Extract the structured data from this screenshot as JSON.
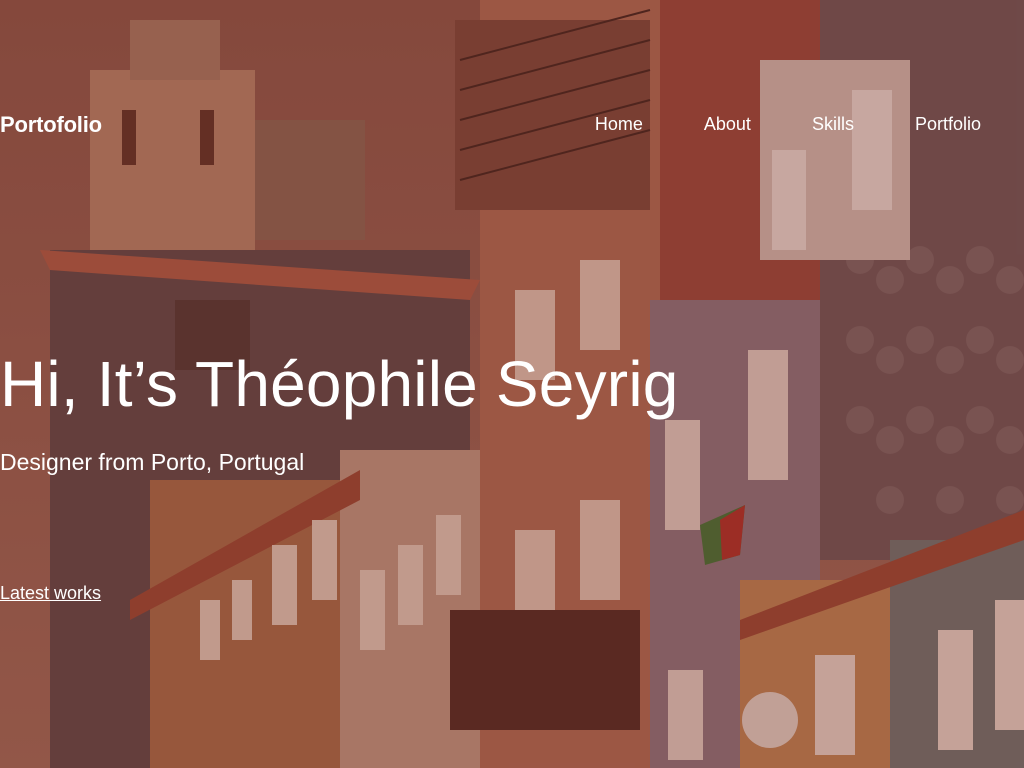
{
  "brand": {
    "logo_text": "Portofolio"
  },
  "nav": {
    "items": [
      {
        "label": "Home"
      },
      {
        "label": "About"
      },
      {
        "label": "Skills"
      },
      {
        "label": "Portfolio"
      }
    ]
  },
  "hero": {
    "headline": "Hi, It’s Théophile Seyrig",
    "subheadline": "Designer from Porto, Portugal",
    "cta_label": "Latest works"
  },
  "colors": {
    "overlay": "#7a2f22",
    "text": "#ffffff"
  }
}
